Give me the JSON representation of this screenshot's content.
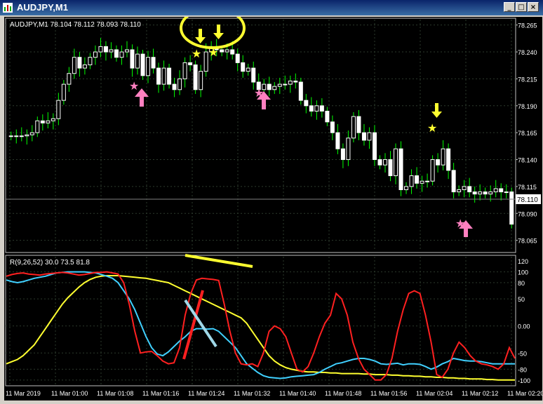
{
  "window": {
    "title": "AUDJPY,M1",
    "min": "_",
    "max": "□",
    "close": "×"
  },
  "price_panel": {
    "info": "AUDJPY,M1  78.104 78.112 78.093 78.110",
    "current_price": "78.110",
    "y_labels": [
      "78.265",
      "78.240",
      "78.215",
      "78.190",
      "78.165",
      "78.140",
      "78.115",
      "78.090",
      "78.065"
    ]
  },
  "indicator_panel": {
    "info": "R(9,26,52) 30.0 73.5 81.8",
    "y_labels": [
      "120",
      "100",
      "80",
      "50",
      "0.00",
      "-50",
      "-80",
      "-100"
    ]
  },
  "time_labels": [
    "11 Mar 2019",
    "11 Mar 01:00",
    "11 Mar 01:08",
    "11 Mar 01:16",
    "11 Mar 01:24",
    "11 Mar 01:32",
    "11 Mar 01:40",
    "11 Mar 01:48",
    "11 Mar 01:56",
    "11 Mar 02:04",
    "11 Mar 02:12",
    "11 Mar 02:20"
  ],
  "colors": {
    "bull": "#ffffff",
    "bear": "#ffffff",
    "wick": "#00ff00",
    "grid": "#2c3a2c",
    "red": "#ff2020",
    "cyan": "#40d0ff",
    "yellow": "#ffff30",
    "pink": "#ff80c0"
  },
  "chart_data": {
    "type": "candlestick",
    "closes": [
      78.162,
      78.162,
      78.162,
      78.163,
      78.165,
      78.176,
      78.174,
      78.176,
      78.178,
      78.195,
      78.21,
      78.22,
      78.235,
      78.225,
      78.228,
      78.235,
      78.24,
      78.245,
      78.24,
      78.242,
      78.235,
      78.24,
      78.242,
      78.225,
      78.238,
      78.218,
      78.235,
      78.225,
      78.21,
      78.225,
      78.21,
      78.205,
      78.215,
      78.23,
      78.228,
      78.205,
      78.222,
      78.24,
      78.245,
      78.242,
      78.24,
      78.242,
      78.238,
      78.23,
      78.222,
      78.225,
      78.212,
      78.205,
      78.21,
      78.205,
      78.208,
      78.21,
      78.21,
      78.213,
      78.212,
      78.195,
      78.19,
      78.185,
      78.19,
      78.185,
      78.175,
      78.165,
      78.15,
      78.14,
      78.16,
      78.18,
      78.165,
      78.158,
      78.165,
      78.14,
      78.135,
      78.14,
      78.125,
      78.15,
      78.112,
      78.115,
      78.125,
      78.118,
      78.12,
      78.12,
      78.14,
      78.135,
      78.15,
      78.13,
      78.11,
      78.112,
      78.115,
      78.11,
      78.108,
      78.11,
      78.108,
      78.11,
      78.113,
      78.11,
      78.11,
      78.08
    ],
    "opens": [
      78.162,
      78.162,
      78.162,
      78.162,
      78.163,
      78.165,
      78.176,
      78.174,
      78.176,
      78.178,
      78.195,
      78.21,
      78.22,
      78.235,
      78.225,
      78.228,
      78.235,
      78.24,
      78.245,
      78.24,
      78.242,
      78.235,
      78.24,
      78.242,
      78.225,
      78.238,
      78.218,
      78.235,
      78.225,
      78.21,
      78.225,
      78.21,
      78.205,
      78.215,
      78.23,
      78.228,
      78.205,
      78.222,
      78.24,
      78.245,
      78.242,
      78.24,
      78.242,
      78.238,
      78.23,
      78.222,
      78.225,
      78.212,
      78.205,
      78.21,
      78.205,
      78.208,
      78.21,
      78.21,
      78.213,
      78.212,
      78.195,
      78.19,
      78.185,
      78.19,
      78.185,
      78.175,
      78.165,
      78.15,
      78.14,
      78.16,
      78.18,
      78.165,
      78.158,
      78.165,
      78.14,
      78.135,
      78.14,
      78.125,
      78.15,
      78.112,
      78.115,
      78.125,
      78.118,
      78.12,
      78.12,
      78.14,
      78.135,
      78.15,
      78.13,
      78.11,
      78.112,
      78.115,
      78.11,
      78.108,
      78.11,
      78.108,
      78.11,
      78.113,
      78.11,
      78.11
    ],
    "ylim": [
      78.055,
      78.27
    ],
    "ind_ylim": [
      -108,
      128
    ],
    "red": [
      92,
      95,
      97,
      98,
      96,
      95,
      94,
      96,
      97,
      98,
      99,
      98,
      96,
      94,
      95,
      97,
      99,
      99,
      100,
      98,
      96,
      80,
      40,
      -10,
      -50,
      -48,
      -47,
      -55,
      -65,
      -70,
      -68,
      -40,
      20,
      60,
      85,
      88,
      87,
      86,
      84,
      40,
      -10,
      -50,
      -70,
      -72,
      -70,
      -75,
      -50,
      -10,
      0,
      -5,
      -20,
      -50,
      -80,
      -85,
      -75,
      -50,
      -20,
      5,
      20,
      60,
      50,
      20,
      -30,
      -60,
      -80,
      -90,
      -100,
      -100,
      -90,
      -60,
      -10,
      30,
      60,
      65,
      60,
      20,
      -30,
      -90,
      -95,
      -80,
      -50,
      -30,
      -40,
      -55,
      -65,
      -70,
      -72,
      -75,
      -80,
      -70,
      -40,
      -60
    ],
    "cyan": [
      85,
      82,
      80,
      82,
      85,
      88,
      90,
      92,
      95,
      98,
      99,
      100,
      100,
      100,
      100,
      99,
      98,
      95,
      92,
      88,
      80,
      65,
      50,
      30,
      5,
      -20,
      -40,
      -52,
      -55,
      -48,
      -38,
      -28,
      -20,
      -10,
      -5,
      -5,
      -6,
      -5,
      -10,
      -20,
      -30,
      -40,
      -55,
      -70,
      -78,
      -86,
      -92,
      -95,
      -96,
      -97,
      -96,
      -94,
      -93,
      -92,
      -91,
      -90,
      -86,
      -80,
      -75,
      -70,
      -68,
      -65,
      -62,
      -60,
      -60,
      -62,
      -65,
      -70,
      -71,
      -70,
      -69,
      -72,
      -70,
      -70,
      -71,
      -75,
      -80,
      -76,
      -70,
      -66,
      -60,
      -62,
      -64,
      -65,
      -65,
      -66,
      -68,
      -70,
      -70,
      -70,
      -70,
      -70
    ],
    "yellow": [
      -70,
      -66,
      -62,
      -55,
      -45,
      -35,
      -20,
      -5,
      10,
      25,
      40,
      52,
      62,
      72,
      80,
      86,
      90,
      92,
      93,
      93,
      93,
      92,
      91,
      90,
      89,
      88,
      86,
      84,
      82,
      80,
      75,
      70,
      65,
      60,
      55,
      50,
      45,
      40,
      35,
      30,
      25,
      20,
      15,
      5,
      -10,
      -25,
      -40,
      -55,
      -65,
      -72,
      -77,
      -80,
      -82,
      -84,
      -85,
      -85,
      -86,
      -86,
      -87,
      -87,
      -88,
      -88,
      -88,
      -88,
      -89,
      -89,
      -90,
      -90,
      -90,
      -91,
      -91,
      -92,
      -92,
      -93,
      -93,
      -94,
      -94,
      -95,
      -95,
      -96,
      -96,
      -97,
      -97,
      -98,
      -98,
      -98,
      -99,
      -99,
      -100,
      -100,
      -100,
      -100
    ]
  }
}
